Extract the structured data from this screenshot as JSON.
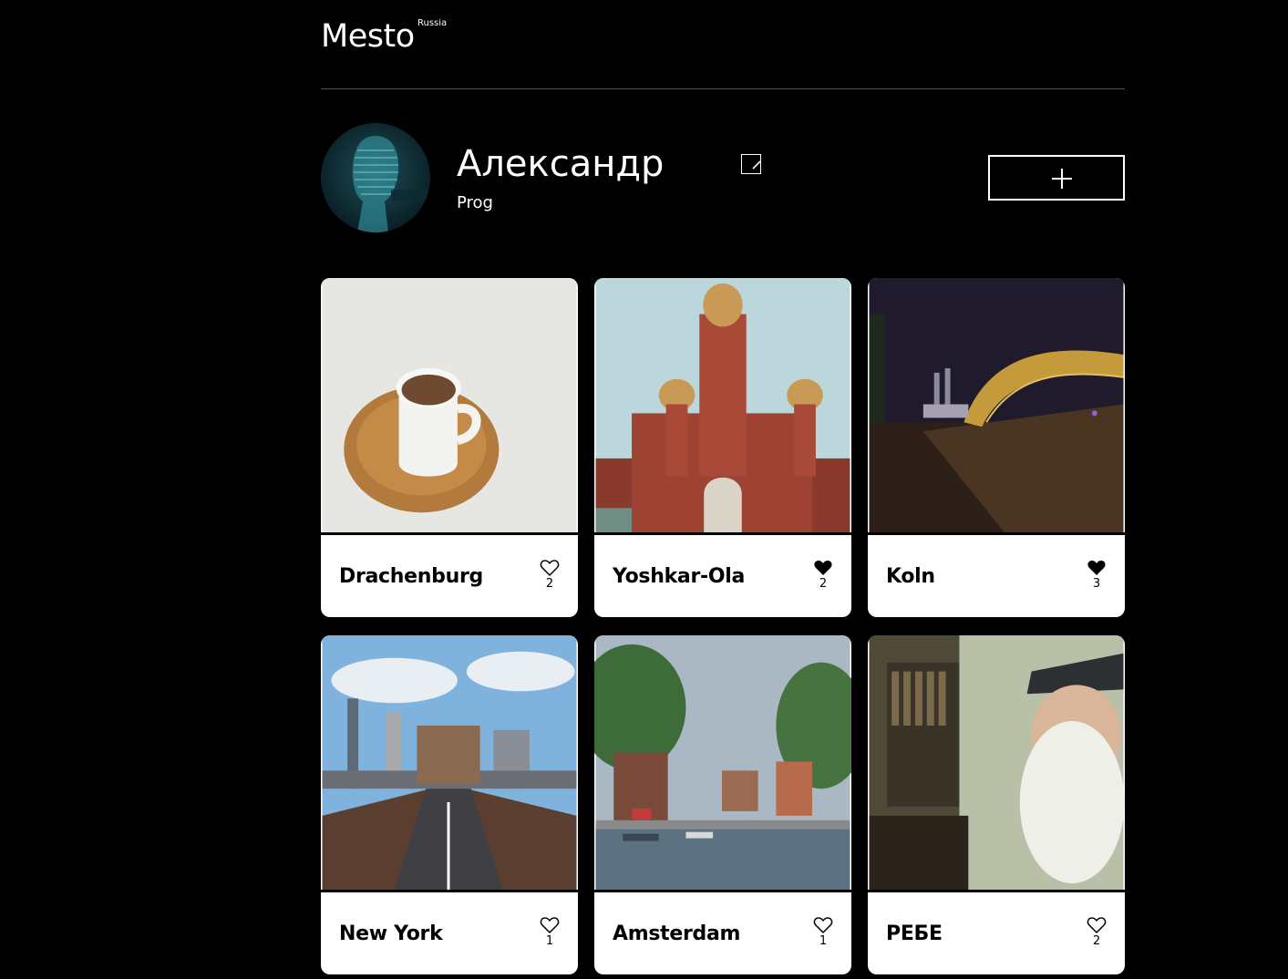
{
  "header": {
    "logo": "Mesto",
    "logo_sup": "Russia"
  },
  "profile": {
    "name": "Александр",
    "job": "Prog"
  },
  "cards": [
    {
      "title": "Drachenburg",
      "likes": "2",
      "liked": false
    },
    {
      "title": "Yoshkar-Ola",
      "likes": "2",
      "liked": true
    },
    {
      "title": "Koln",
      "likes": "3",
      "liked": true
    },
    {
      "title": "New York",
      "likes": "1",
      "liked": false
    },
    {
      "title": "Amsterdam",
      "likes": "1",
      "liked": false
    },
    {
      "title": "РЕБЕ",
      "likes": "2",
      "liked": false
    }
  ],
  "colors": {
    "background": "#000000",
    "card": "#ffffff",
    "divider": "#545454"
  }
}
